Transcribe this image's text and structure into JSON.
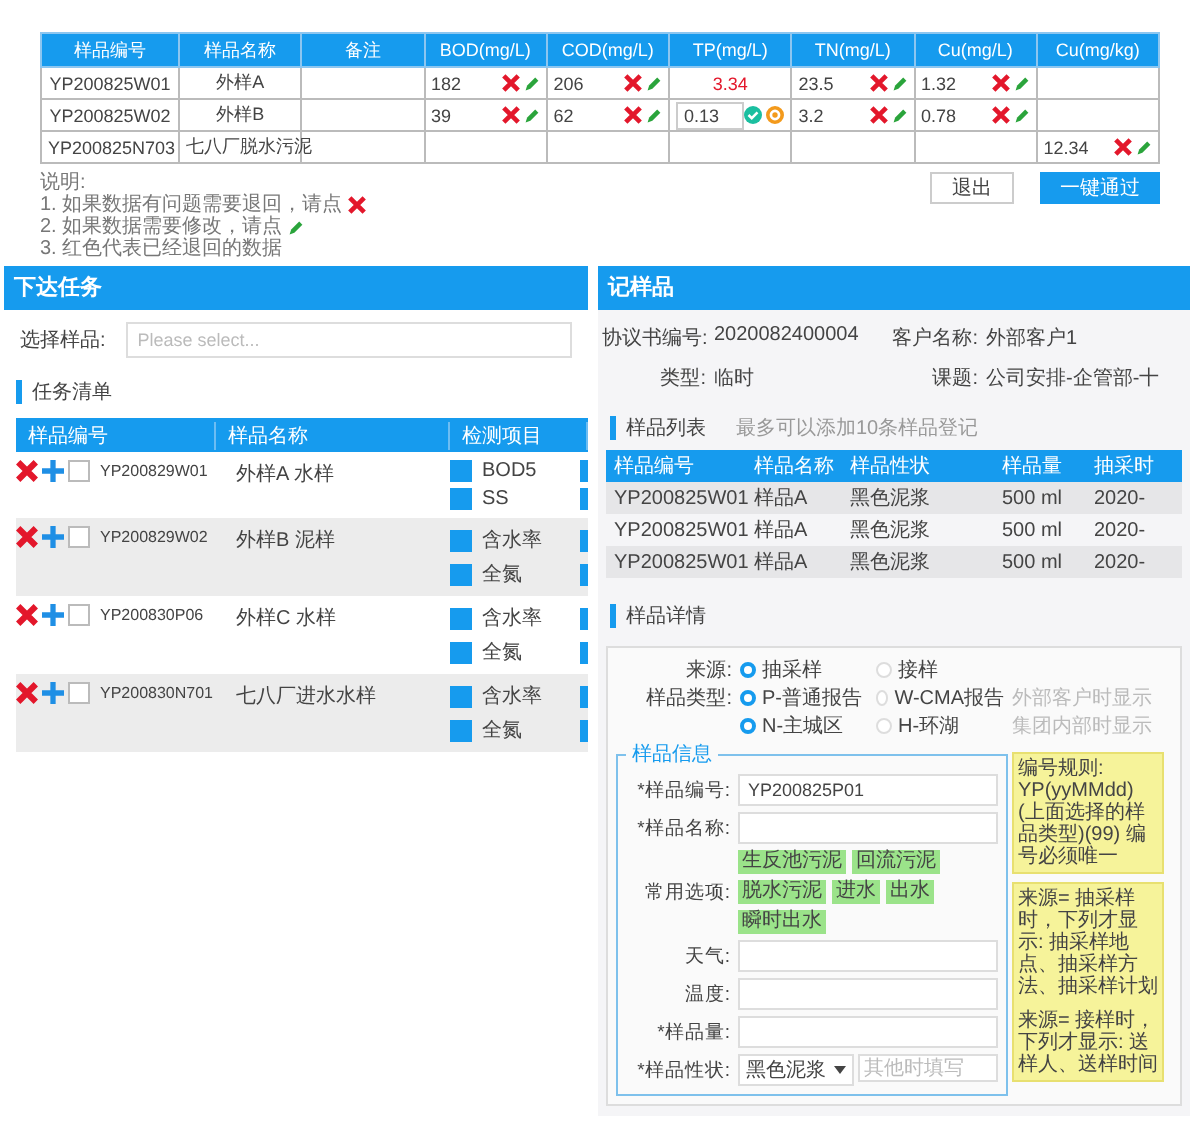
{
  "results_table": {
    "columns": [
      "样品编号",
      "样品名称",
      "备注",
      "BOD(mg/L)",
      "COD(mg/L)",
      "TP(mg/L)",
      "TN(mg/L)",
      "Cu(mg/L)",
      "Cu(mg/kg)"
    ],
    "rows": [
      {
        "cells": [
          {
            "kind": "plain",
            "text": "YP200825W01"
          },
          {
            "kind": "plain",
            "text": "外样A"
          },
          {
            "kind": "empty"
          },
          {
            "kind": "value",
            "text": "182"
          },
          {
            "kind": "value",
            "text": "206"
          },
          {
            "kind": "returned",
            "text": "3.34"
          },
          {
            "kind": "value",
            "text": "23.5"
          },
          {
            "kind": "value",
            "text": "1.32"
          },
          {
            "kind": "empty"
          }
        ]
      },
      {
        "cells": [
          {
            "kind": "plain",
            "text": "YP200825W02"
          },
          {
            "kind": "plain",
            "text": "外样B"
          },
          {
            "kind": "empty"
          },
          {
            "kind": "value",
            "text": "39"
          },
          {
            "kind": "value",
            "text": "62"
          },
          {
            "kind": "editing",
            "text": "0.13"
          },
          {
            "kind": "value",
            "text": "3.2"
          },
          {
            "kind": "value",
            "text": "0.78"
          },
          {
            "kind": "empty"
          }
        ]
      },
      {
        "cells": [
          {
            "kind": "plain",
            "text": "YP200825N703"
          },
          {
            "kind": "plain",
            "text": "七八厂脱水污泥"
          },
          {
            "kind": "empty"
          },
          {
            "kind": "empty"
          },
          {
            "kind": "empty"
          },
          {
            "kind": "empty"
          },
          {
            "kind": "empty"
          },
          {
            "kind": "empty"
          },
          {
            "kind": "value",
            "text": "12.34"
          }
        ]
      }
    ]
  },
  "notes": [
    "说明:",
    "1. 如果数据有问题需要退回，请点",
    "2. 如果数据需要修改，请点",
    "3. 红色代表已经退回的数据"
  ],
  "buttons": [
    {
      "label": "退出",
      "primary": false
    },
    {
      "label": "一键通过",
      "primary": true
    }
  ],
  "task_panel": {
    "title": "下达任务",
    "select_label": "选择样品:",
    "select_placeholder": "Please select...",
    "section": "任务清单",
    "columns": [
      "样品编号",
      "样品名称",
      "检测项目"
    ],
    "rows": [
      {
        "id": "YP200829W01",
        "name": "外样A 水样",
        "checked": false,
        "tests": [
          {
            "label": "BOD5",
            "checked": true,
            "next_checked": true
          },
          {
            "label": "SS",
            "checked": true,
            "next_checked": true
          }
        ]
      },
      {
        "id": "YP200829W02",
        "name": "外样B 泥样",
        "checked": false,
        "tests": [
          {
            "label": "含水率",
            "checked": true,
            "next_checked": true
          },
          {
            "label": "全氮",
            "checked": true,
            "next_checked": true
          }
        ]
      },
      {
        "id": "YP200830P06",
        "name": "外样C 水样",
        "checked": false,
        "tests": [
          {
            "label": "含水率",
            "checked": true,
            "next_checked": true
          },
          {
            "label": "全氮",
            "checked": true,
            "next_checked": true
          }
        ]
      },
      {
        "id": "YP200830N701",
        "name": "七八厂进水水样",
        "checked": false,
        "tests": [
          {
            "label": "含水率",
            "checked": true,
            "next_checked": true
          },
          {
            "label": "全氮",
            "checked": true,
            "next_checked": true
          }
        ]
      }
    ]
  },
  "register_panel": {
    "title": "记样品",
    "info": [
      {
        "label": "协议书编号:",
        "value": "2020082400004"
      },
      {
        "label": "客户名称:",
        "value": "外部客户1"
      },
      {
        "label": "类型:",
        "value": "临时"
      },
      {
        "label": "课题:",
        "value": "公司安排-企管部-十"
      }
    ],
    "list_section": "样品列表",
    "list_hint": "最多可以添加10条样品登记",
    "list_columns": [
      "样品编号",
      "样品名称",
      "样品性状",
      "样品量",
      "抽采时"
    ],
    "list_rows": [
      [
        "YP200825W01",
        "样品A",
        "黑色泥浆",
        "500 ml",
        "2020-"
      ],
      [
        "YP200825W01",
        "样品A",
        "黑色泥浆",
        "500 ml",
        "2020-"
      ],
      [
        "YP200825W01",
        "样品A",
        "黑色泥浆",
        "500 ml",
        "2020-"
      ]
    ],
    "detail_section": "样品详情",
    "radio_groups": [
      {
        "label": "来源:",
        "options": [
          {
            "label": "抽采样",
            "selected": true
          },
          {
            "label": "接样",
            "selected": false
          }
        ]
      },
      {
        "label": "样品类型:",
        "options": [
          {
            "label": "P-普通报告",
            "selected": true
          },
          {
            "label": "W-CMA报告",
            "selected": false
          }
        ],
        "hint": "外部客户时显示"
      },
      {
        "options": [
          {
            "label": "N-主城区",
            "selected": true
          },
          {
            "label": "H-环湖",
            "selected": false
          }
        ],
        "hint": "集团内部时显示"
      }
    ],
    "info_legend": "样品信息",
    "fields": [
      {
        "kind": "input",
        "label": "*样品编号:",
        "value": "YP200825P01"
      },
      {
        "kind": "input",
        "label": "*样品名称:"
      },
      {
        "kind": "tags",
        "label": "常用选项:",
        "tags": [
          "生反池污泥",
          "回流污泥",
          "脱水污泥",
          "进水",
          "出水",
          "瞬时出水"
        ]
      },
      {
        "kind": "input",
        "label": "天气:"
      },
      {
        "kind": "input",
        "label": "温度:"
      },
      {
        "kind": "input",
        "label": "*样品量:"
      },
      {
        "kind": "select",
        "label": "*样品性状:",
        "value": "黑色泥浆",
        "placeholder": "其他时填写"
      }
    ],
    "notes": [
      "编号规则: YP(yyMMdd)(上面选择的样品类型)(99) 编号必须唯一",
      "来源= 抽采样时，下列才显示: 抽采样地点、抽采样方法、抽采样计划",
      "来源= 接样时，下列才显示: 送样人、送样时间"
    ]
  }
}
